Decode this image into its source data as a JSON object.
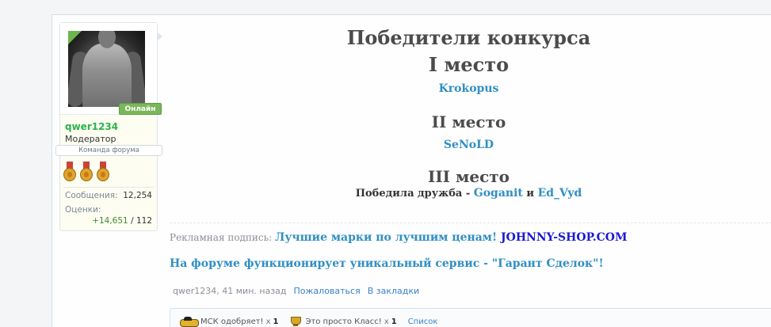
{
  "user": {
    "online_label": "Онлайн",
    "username": "qwer1234",
    "title": "Модератор",
    "team_badge": "Команда форума",
    "stats": [
      {
        "label": "Сообщения:",
        "value": "12,254"
      },
      {
        "label": "Оценки:",
        "value": ""
      }
    ],
    "rating_positive": "+14,651",
    "rating_sep": " / ",
    "rating_total": "112"
  },
  "message": {
    "heading": "Победители конкурса",
    "place1": "I место",
    "winner1": "Krokopus",
    "place2": "II место",
    "winner2": "SeNoLD",
    "place3": "III место",
    "place3_text": "Победила дружба - ",
    "winner3a": "Goganit",
    "and": " и ",
    "winner3b": "Ed_Vyd"
  },
  "signature": {
    "label": "Рекламная подпись: ",
    "link": "Лучшие марки по лучшим ценам!",
    "shop": " JOHNNY-SHOP.COM",
    "line2": "На форуме функционирует уникальный сервис - \"Гарант Сделок\"!"
  },
  "meta": {
    "author_time": "qwer1234, 41 мин. назад",
    "report": "Пожаловаться",
    "bookmark": "В закладки"
  },
  "likes": {
    "items": [
      {
        "label": "МСК одобряет!",
        "x": "x",
        "count": "1",
        "icon": "car-icon"
      },
      {
        "label": "Это просто Класс!",
        "x": "x",
        "count": "1",
        "icon": "cup-icon"
      }
    ],
    "list_link": "Список"
  },
  "colors": {
    "username": "#29b34a",
    "online": "#7ab65a",
    "link": "#2f8fc4",
    "shop": "#1a1ad4"
  }
}
